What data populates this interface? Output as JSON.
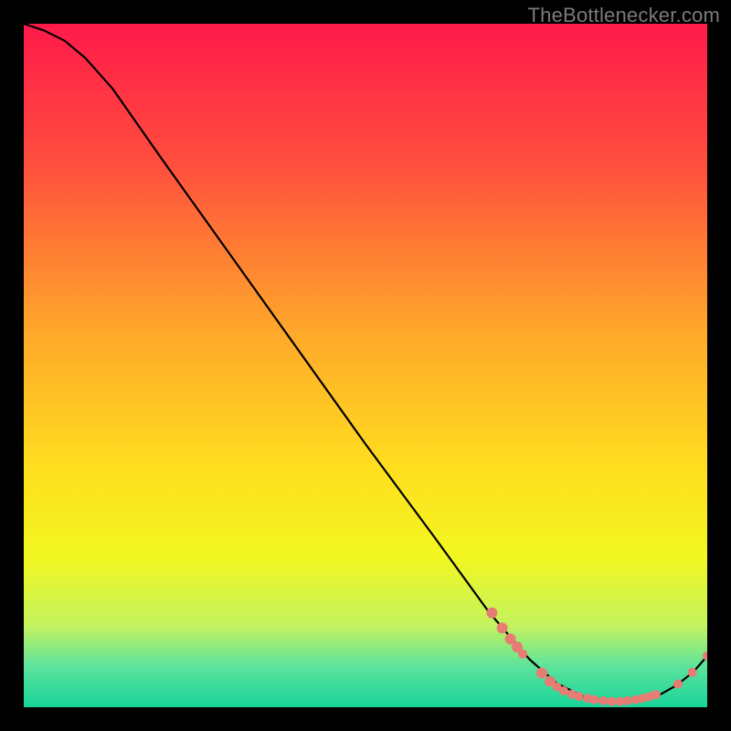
{
  "watermark": "TheBottlenecker.com",
  "chart_data": {
    "type": "line",
    "title": "",
    "xlabel": "",
    "ylabel": "",
    "xlim": [
      0,
      100
    ],
    "ylim": [
      0,
      100
    ],
    "grid": false,
    "legend": false,
    "background_gradient": {
      "stops": [
        {
          "offset": 0.0,
          "color": "#ff1a4a"
        },
        {
          "offset": 0.2,
          "color": "#ff4d3e"
        },
        {
          "offset": 0.45,
          "color": "#ffa82a"
        },
        {
          "offset": 0.65,
          "color": "#ffde1f"
        },
        {
          "offset": 0.78,
          "color": "#f2f720"
        },
        {
          "offset": 0.88,
          "color": "#c4f35e"
        },
        {
          "offset": 0.94,
          "color": "#5de39c"
        },
        {
          "offset": 1.0,
          "color": "#18d49a"
        }
      ]
    },
    "series": [
      {
        "name": "curve",
        "points": [
          {
            "x": 0.0,
            "y": 100.0
          },
          {
            "x": 3.0,
            "y": 99.0
          },
          {
            "x": 6.0,
            "y": 97.5
          },
          {
            "x": 9.0,
            "y": 95.0
          },
          {
            "x": 13.0,
            "y": 90.5
          },
          {
            "x": 20.0,
            "y": 80.5
          },
          {
            "x": 30.0,
            "y": 66.5
          },
          {
            "x": 40.0,
            "y": 52.5
          },
          {
            "x": 50.0,
            "y": 38.5
          },
          {
            "x": 60.0,
            "y": 25.0
          },
          {
            "x": 68.0,
            "y": 14.0
          },
          {
            "x": 74.0,
            "y": 7.0
          },
          {
            "x": 78.0,
            "y": 3.5
          },
          {
            "x": 82.0,
            "y": 1.5
          },
          {
            "x": 86.0,
            "y": 0.8
          },
          {
            "x": 90.0,
            "y": 1.0
          },
          {
            "x": 93.0,
            "y": 1.8
          },
          {
            "x": 95.5,
            "y": 3.2
          },
          {
            "x": 98.0,
            "y": 5.2
          },
          {
            "x": 100.0,
            "y": 7.5
          }
        ]
      }
    ],
    "dots": [
      {
        "x": 68.5,
        "y": 13.8,
        "r": 6
      },
      {
        "x": 70.0,
        "y": 11.6,
        "r": 6
      },
      {
        "x": 71.2,
        "y": 10.0,
        "r": 6
      },
      {
        "x": 72.2,
        "y": 8.8,
        "r": 6
      },
      {
        "x": 73.0,
        "y": 7.8,
        "r": 5
      },
      {
        "x": 75.8,
        "y": 5.0,
        "r": 6
      },
      {
        "x": 77.0,
        "y": 3.8,
        "r": 6
      },
      {
        "x": 78.0,
        "y": 3.0,
        "r": 5
      },
      {
        "x": 79.0,
        "y": 2.4,
        "r": 5
      },
      {
        "x": 80.2,
        "y": 1.9,
        "r": 5
      },
      {
        "x": 81.2,
        "y": 1.6,
        "r": 5
      },
      {
        "x": 82.5,
        "y": 1.3,
        "r": 5
      },
      {
        "x": 83.5,
        "y": 1.1,
        "r": 5
      },
      {
        "x": 84.8,
        "y": 0.95,
        "r": 5
      },
      {
        "x": 86.0,
        "y": 0.85,
        "r": 5
      },
      {
        "x": 87.2,
        "y": 0.85,
        "r": 5
      },
      {
        "x": 88.3,
        "y": 0.95,
        "r": 5
      },
      {
        "x": 89.5,
        "y": 1.1,
        "r": 5
      },
      {
        "x": 90.5,
        "y": 1.3,
        "r": 5
      },
      {
        "x": 91.5,
        "y": 1.55,
        "r": 5
      },
      {
        "x": 92.5,
        "y": 1.85,
        "r": 5
      },
      {
        "x": 95.7,
        "y": 3.4,
        "r": 5
      },
      {
        "x": 97.8,
        "y": 5.1,
        "r": 5
      },
      {
        "x": 100.0,
        "y": 7.5,
        "r": 5
      }
    ],
    "dot_color": "#e77c74",
    "curve_color": "#000000"
  }
}
